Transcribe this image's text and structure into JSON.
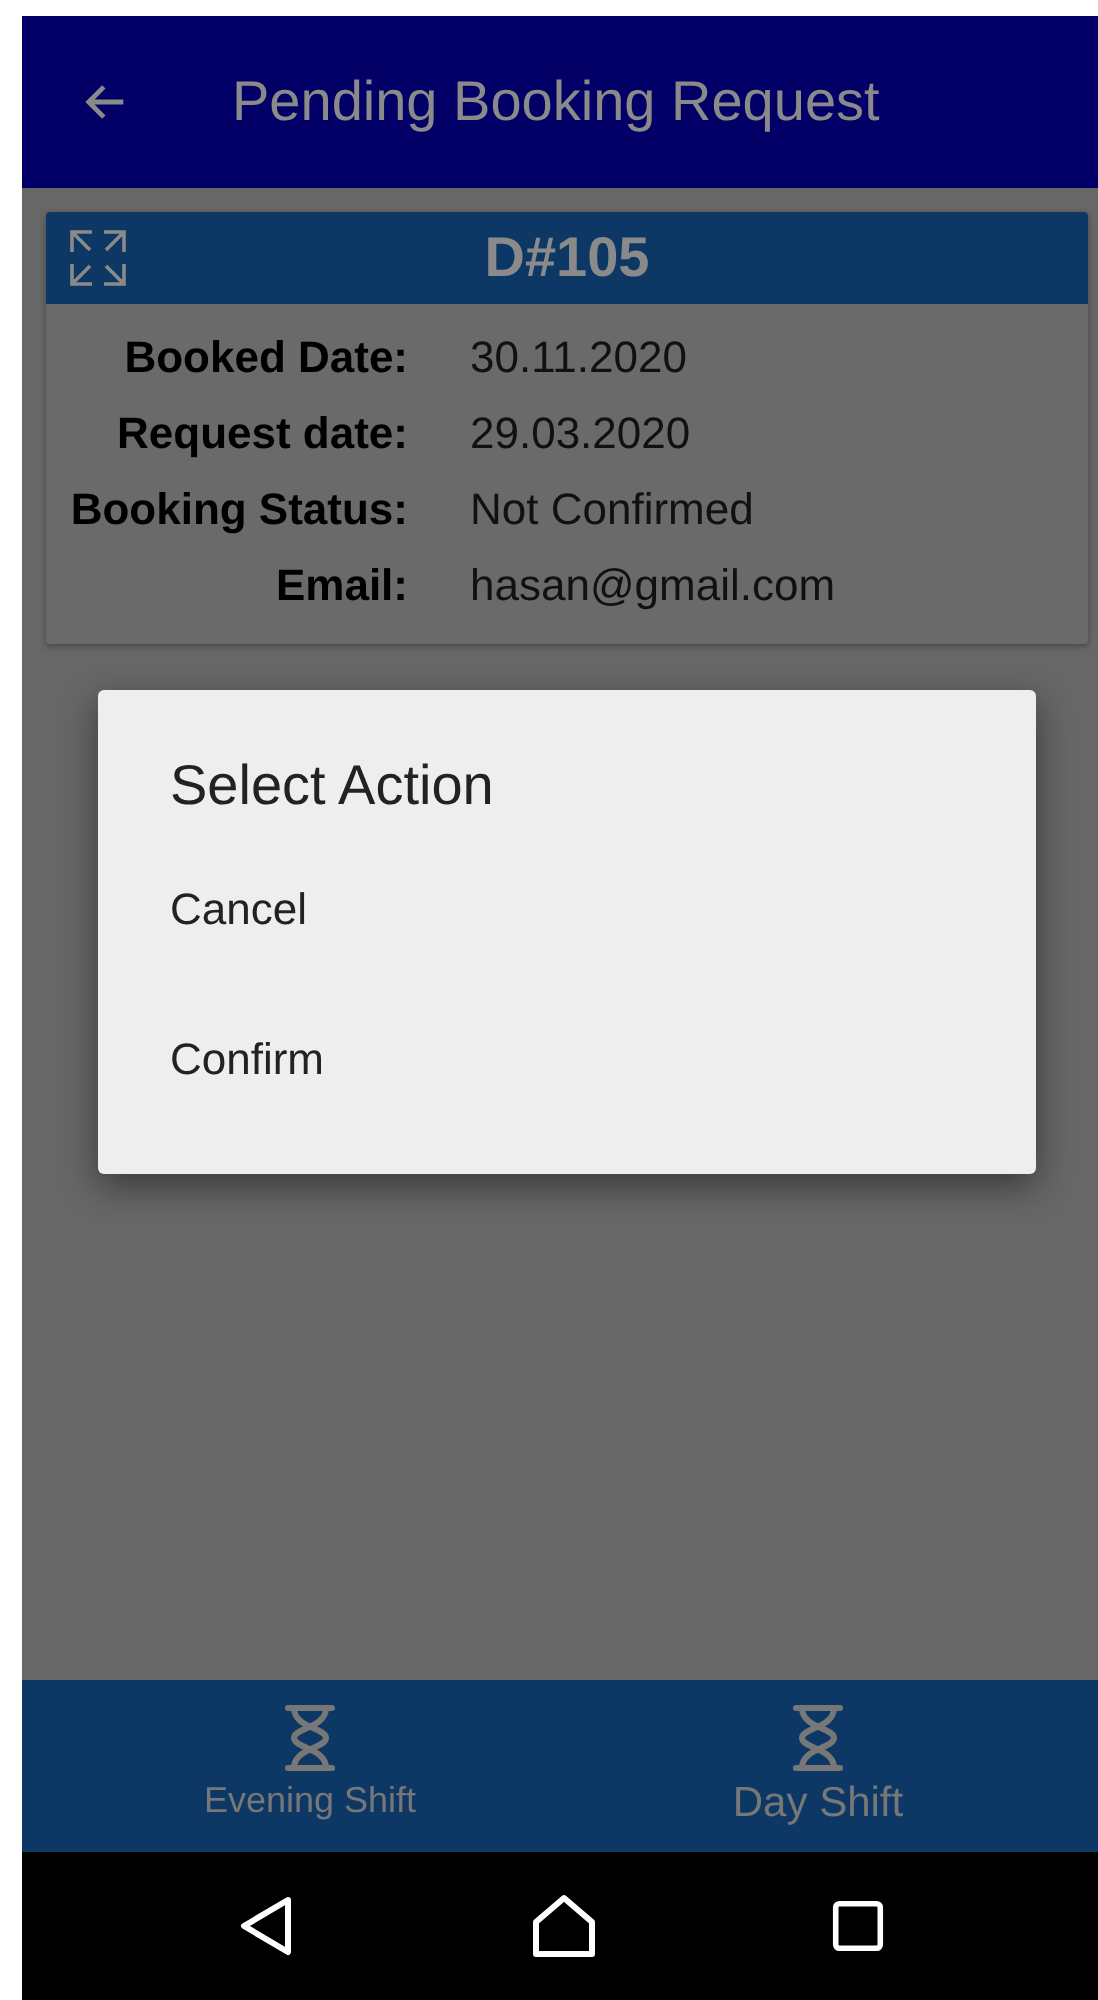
{
  "app_bar": {
    "title": "Pending Booking Request"
  },
  "booking_card": {
    "title": "D#105",
    "fields": [
      {
        "label": "Booked Date:",
        "value": "30.11.2020"
      },
      {
        "label": "Request date:",
        "value": "29.03.2020"
      },
      {
        "label": "Booking Status:",
        "value": "Not Confirmed"
      },
      {
        "label": "Email:",
        "value": "hasan@gmail.com"
      }
    ]
  },
  "dialog": {
    "title": "Select Action",
    "options": [
      "Cancel",
      "Confirm"
    ]
  },
  "bottom_tabs": [
    {
      "label": "Evening Shift"
    },
    {
      "label": "Day Shift"
    }
  ]
}
